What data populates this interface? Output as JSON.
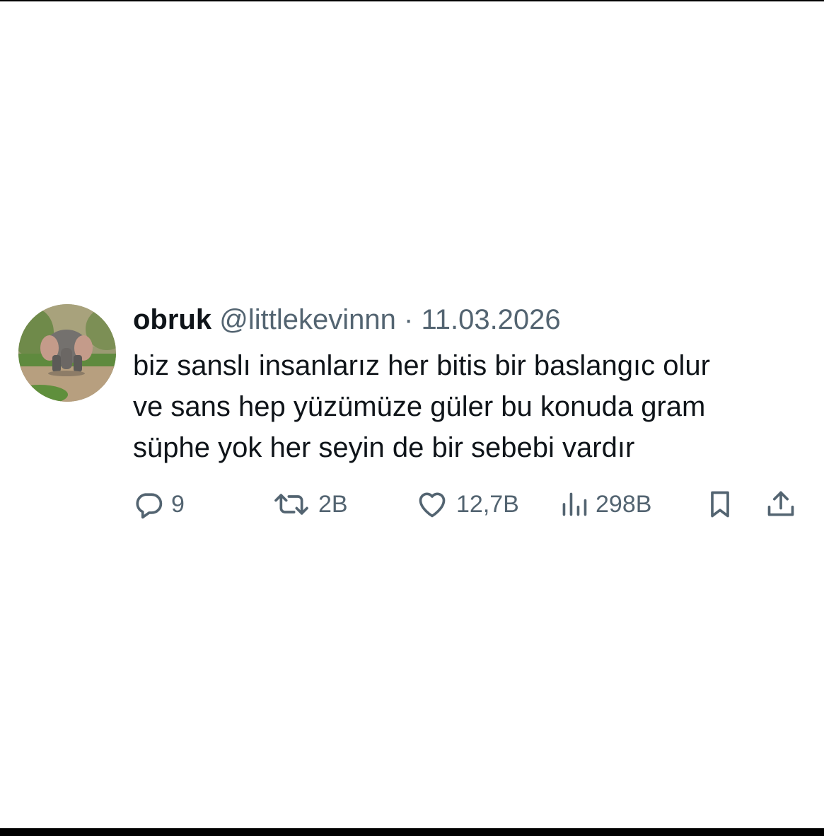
{
  "tweet": {
    "display_name": "obruk",
    "handle": "@littlekevinnn",
    "separator": "·",
    "date": "11.03.2026",
    "text_lines": [
      "biz sanslı insanlarız her bitis bir baslangıc olur",
      "ve sans hep yüzümüze güler bu konuda gram",
      "süphe yok her seyin de bir sebebi vardır"
    ],
    "avatar_icon": "elephant-avatar"
  },
  "actions": {
    "reply": {
      "icon": "reply-icon",
      "count": "9"
    },
    "repost": {
      "icon": "repost-icon",
      "count": "2B"
    },
    "like": {
      "icon": "heart-icon",
      "count": "12,7B"
    },
    "views": {
      "icon": "views-icon",
      "count": "298B"
    },
    "bookmark": {
      "icon": "bookmark-icon"
    },
    "share": {
      "icon": "share-icon"
    }
  },
  "colors": {
    "text_primary": "#0f1419",
    "text_secondary": "#536471",
    "background": "#ffffff"
  }
}
